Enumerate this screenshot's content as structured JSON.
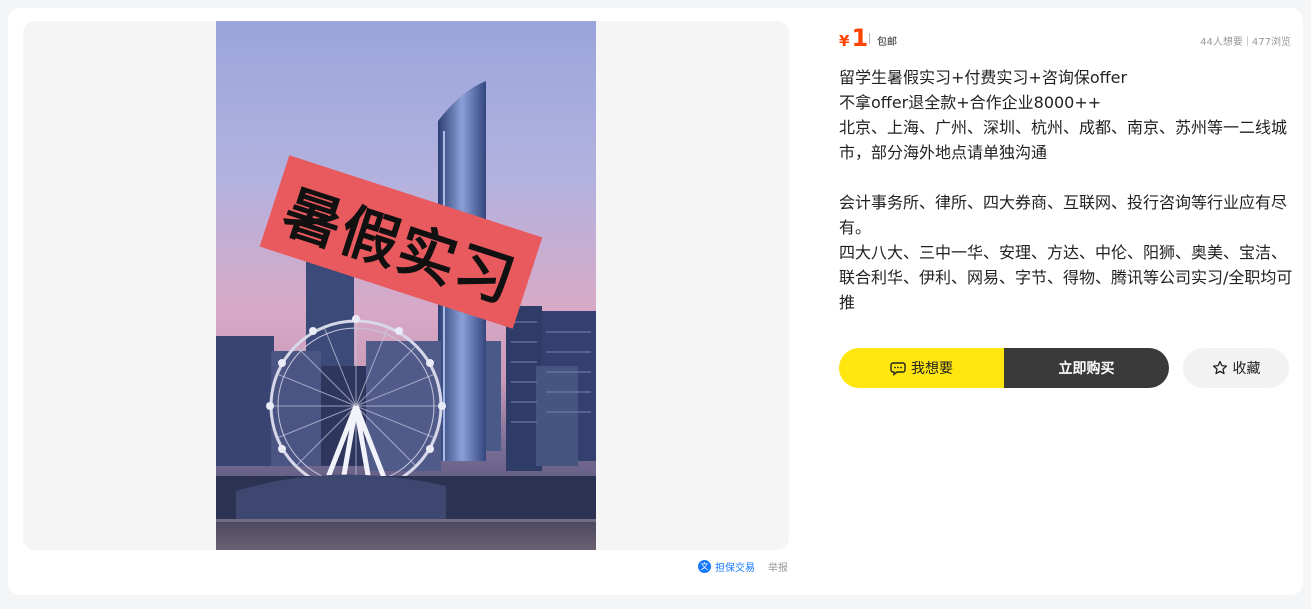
{
  "gallery": {
    "banner_text": "暑假实习"
  },
  "trade": {
    "guarantee_icon": "文",
    "guarantee_label": "担保交易",
    "report_label": "举报"
  },
  "price": {
    "currency": "¥",
    "amount": "1",
    "shipping": "包邮",
    "color": "#ff4400"
  },
  "stats": {
    "wants": "44人想要",
    "views": "477浏览"
  },
  "description": {
    "lines": [
      "留学生暑假实习+付费实习+咨询保offer",
      "不拿offer退全款+合作企业8000++",
      "北京、上海、广州、深圳、杭州、成都、南京、苏州等一二线城市，部分海外地点请单独沟通",
      "",
      "会计事务所、律所、四大券商、互联网、投行咨询等行业应有尽有。",
      "四大八大、三中一华、安理、方达、中伦、阳狮、奥美、宝洁、联合利华、伊利、网易、字节、得物、腾讯等公司实习/全职均可推"
    ]
  },
  "actions": {
    "want_label": "我想要",
    "buy_label": "立即购买",
    "favorite_label": "收藏",
    "want_color": "#ffe60f",
    "buy_color": "#3a3a3a"
  }
}
